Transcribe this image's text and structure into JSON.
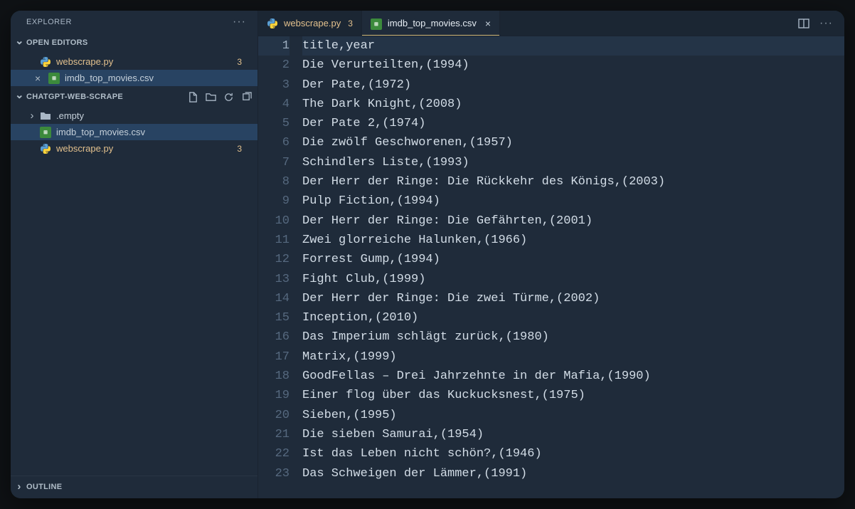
{
  "sidebar": {
    "title": "EXPLORER",
    "open_editors_label": "OPEN EDITORS",
    "workspace_label": "CHATGPT-WEB-SCRAPE",
    "outline_label": "OUTLINE",
    "open_editors": [
      {
        "name": "webscrape.py",
        "icon": "python",
        "dirty_badge": "3",
        "active": false
      },
      {
        "name": "imdb_top_movies.csv",
        "icon": "csv",
        "dirty_badge": "",
        "active": true,
        "closeable": true
      }
    ],
    "tree": [
      {
        "name": ".empty",
        "icon": "folder",
        "expandable": true
      },
      {
        "name": "imdb_top_movies.csv",
        "icon": "csv",
        "selected": true
      },
      {
        "name": "webscrape.py",
        "icon": "python",
        "dirty_badge": "3"
      }
    ]
  },
  "tabs": [
    {
      "name": "webscrape.py",
      "icon": "python",
      "dirty_badge": "3",
      "active": false
    },
    {
      "name": "imdb_top_movies.csv",
      "icon": "csv",
      "active": true,
      "closeable": true
    }
  ],
  "editor": {
    "current_line": 1,
    "lines": [
      "title,year",
      "Die Verurteilten,(1994)",
      "Der Pate,(1972)",
      "The Dark Knight,(2008)",
      "Der Pate 2,(1974)",
      "Die zwölf Geschworenen,(1957)",
      "Schindlers Liste,(1993)",
      "Der Herr der Ringe: Die Rückkehr des Königs,(2003)",
      "Pulp Fiction,(1994)",
      "Der Herr der Ringe: Die Gefährten,(2001)",
      "Zwei glorreiche Halunken,(1966)",
      "Forrest Gump,(1994)",
      "Fight Club,(1999)",
      "Der Herr der Ringe: Die zwei Türme,(2002)",
      "Inception,(2010)",
      "Das Imperium schlägt zurück,(1980)",
      "Matrix,(1999)",
      "GoodFellas – Drei Jahrzehnte in der Mafia,(1990)",
      "Einer flog über das Kuckucksnest,(1975)",
      "Sieben,(1995)",
      "Die sieben Samurai,(1954)",
      "Ist das Leben nicht schön?,(1946)",
      "Das Schweigen der Lämmer,(1991)"
    ]
  }
}
